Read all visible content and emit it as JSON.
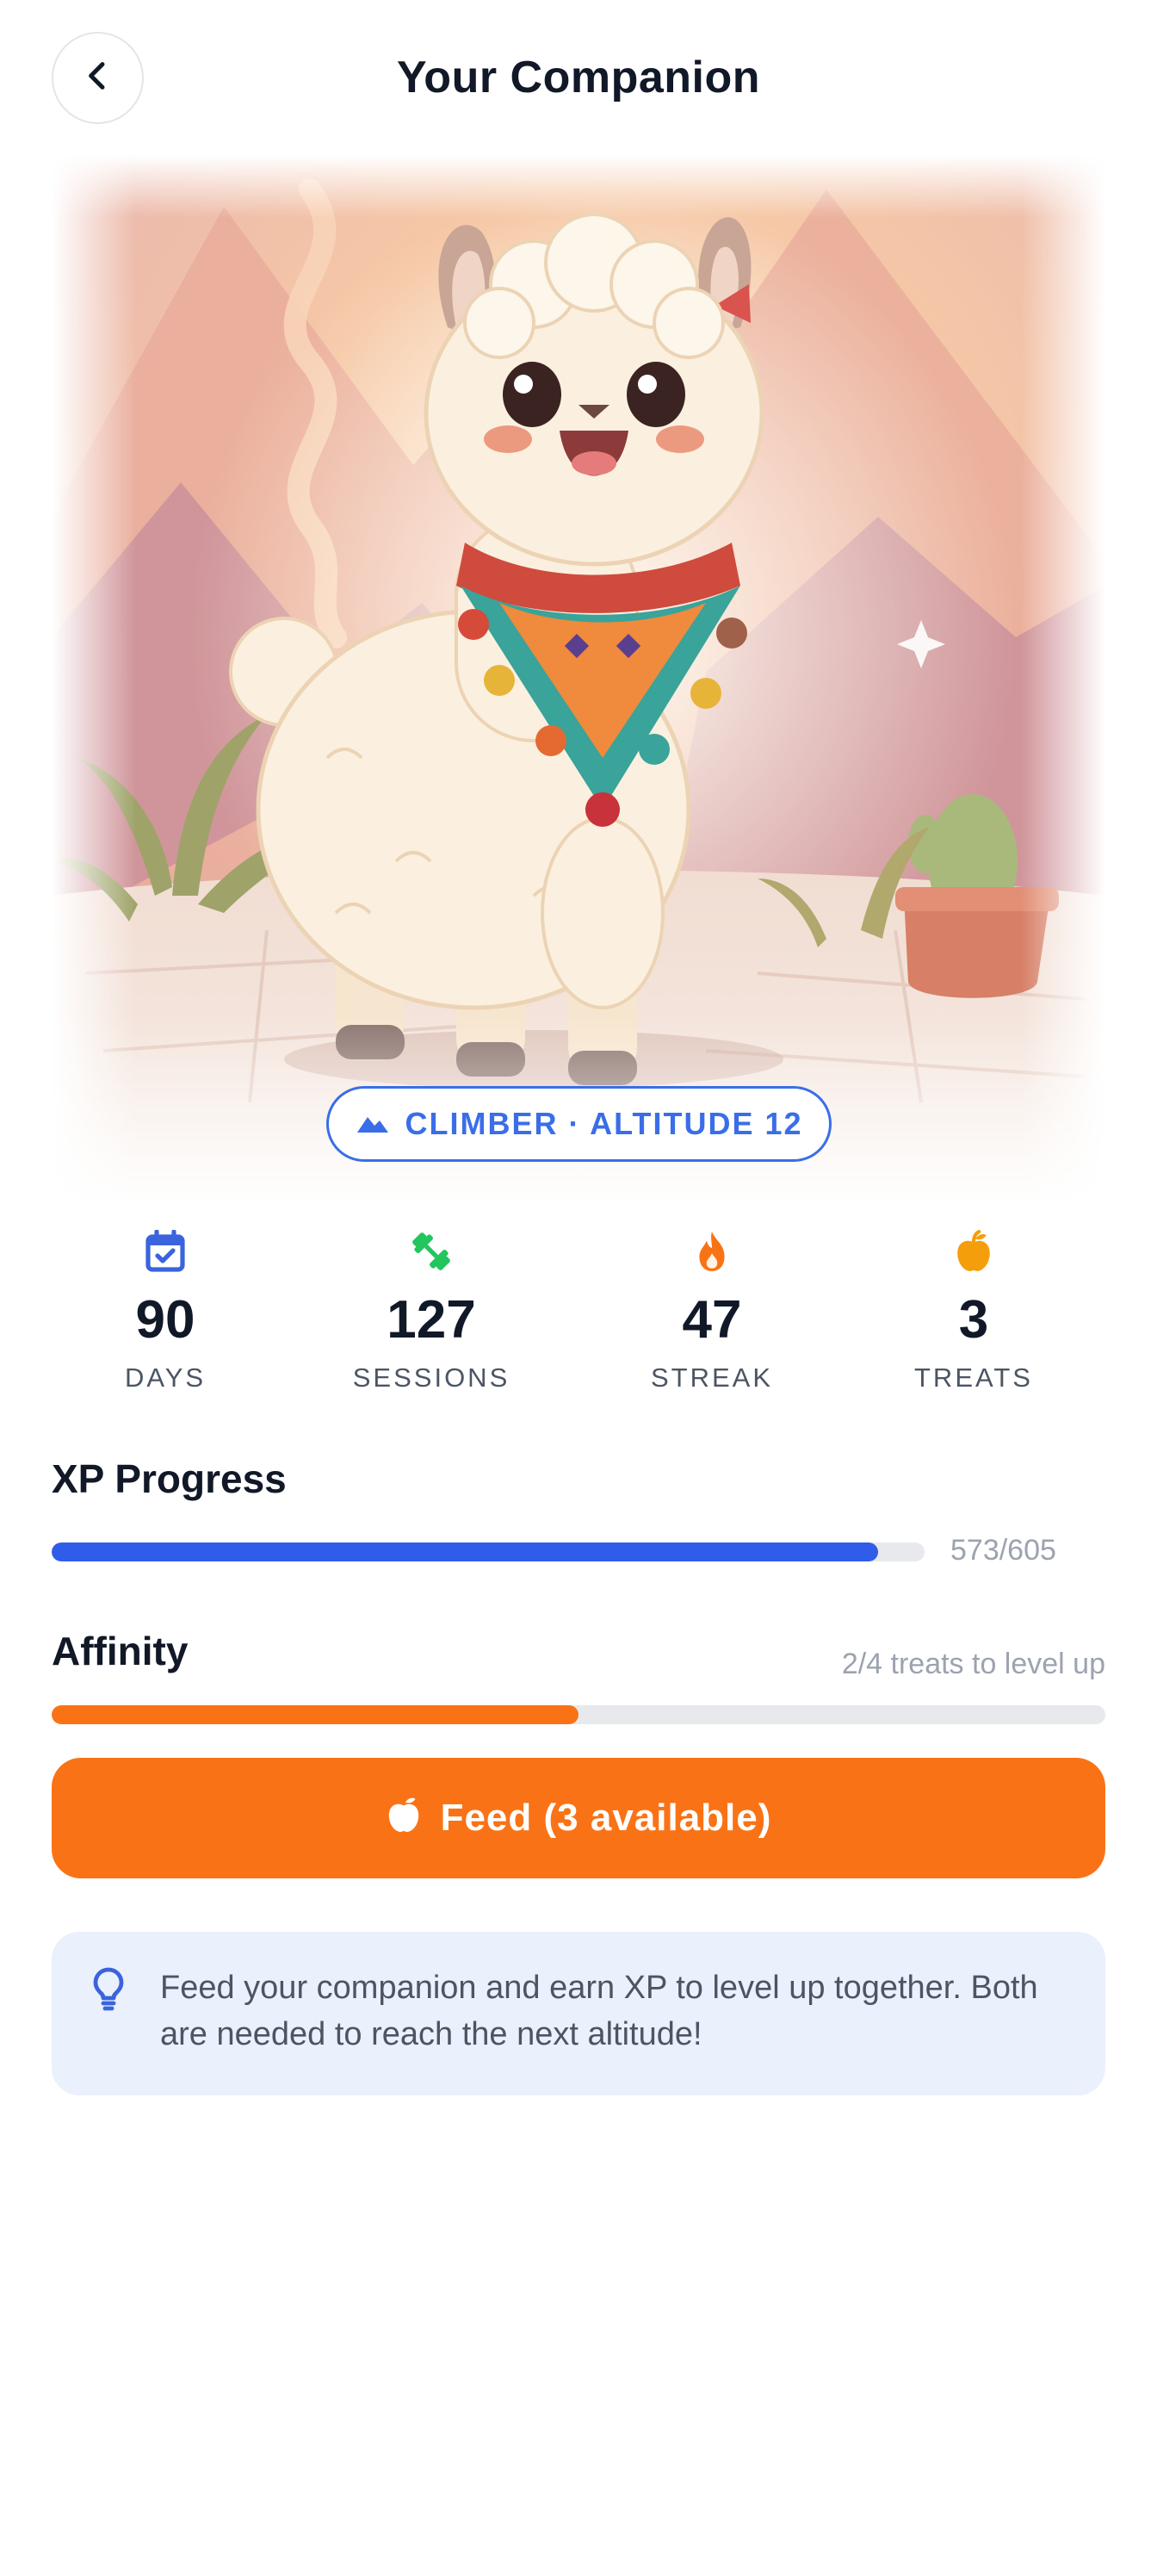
{
  "header": {
    "title": "Your Companion",
    "back_icon": "chevron-left-icon"
  },
  "hero": {
    "illustration": "alpaca-companion-illustration",
    "rank_icon": "mountain-icon",
    "rank_label": "CLIMBER · ALTITUDE 12"
  },
  "stats": [
    {
      "icon": "calendar-check-icon",
      "value": "90",
      "label": "DAYS",
      "color": "#3a63dd"
    },
    {
      "icon": "dumbbell-icon",
      "value": "127",
      "label": "SESSIONS",
      "color": "#22c55e"
    },
    {
      "icon": "flame-icon",
      "value": "47",
      "label": "STREAK",
      "color": "#f97316"
    },
    {
      "icon": "apple-icon",
      "value": "3",
      "label": "TREATS",
      "color": "#f59e0b"
    }
  ],
  "xp": {
    "title": "XP Progress",
    "current": 573,
    "max": 605,
    "text": "573/605",
    "color": "#2f5ce8"
  },
  "affinity": {
    "title": "Affinity",
    "current": 2,
    "max": 4,
    "text": "2/4 treats to level up",
    "color": "#f97316"
  },
  "feed_button": {
    "icon": "apple-icon",
    "label": "Feed (3 available)",
    "color": "#f97316"
  },
  "tip": {
    "icon": "lightbulb-icon",
    "text": "Feed your companion and earn XP to level up together. Both are needed to reach the next altitude!"
  }
}
